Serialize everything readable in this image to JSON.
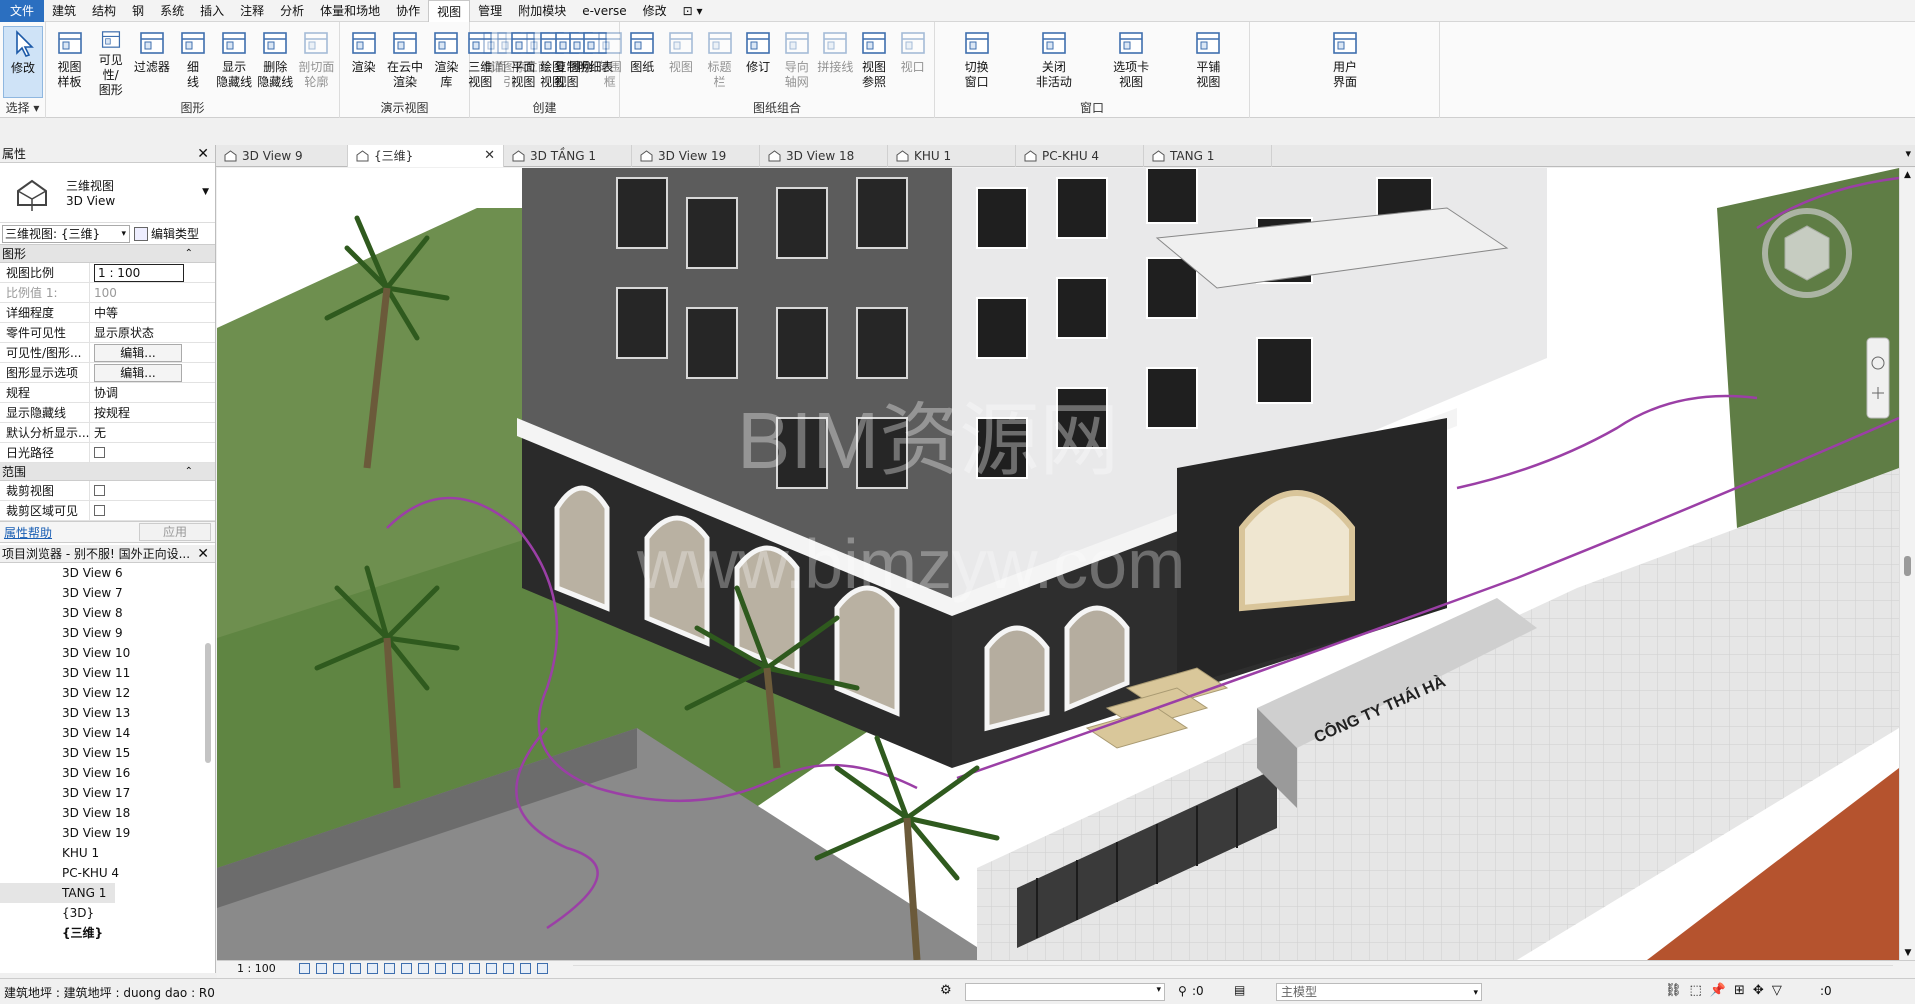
{
  "menus": [
    "文件",
    "建筑",
    "结构",
    "钢",
    "系统",
    "插入",
    "注释",
    "分析",
    "体量和场地",
    "协作",
    "视图",
    "管理",
    "附加模块",
    "e-verse",
    "修改",
    "⊡ ▾"
  ],
  "active_menu_index": 10,
  "ribbon": {
    "groups": [
      {
        "label": "选择 ▾",
        "buttons": [
          {
            "label": "修改",
            "icon": "cursor-icon",
            "selected": true
          }
        ]
      },
      {
        "label": "图形",
        "buttons": [
          {
            "label": "视图\n样板",
            "icon": "view-template-icon"
          },
          {
            "label": "可见性/\n图形",
            "icon": "visibility-icon"
          },
          {
            "label": "过滤器",
            "icon": "filter-icon"
          },
          {
            "label": "细\n线",
            "icon": "thin-lines-icon"
          },
          {
            "label": "显示\n隐藏线",
            "icon": "show-hidden-icon"
          },
          {
            "label": "删除\n隐藏线",
            "icon": "remove-hidden-icon"
          },
          {
            "label": "剖切面\n轮廓",
            "icon": "cut-profile-icon",
            "disabled": true
          }
        ]
      },
      {
        "label": "演示视图",
        "buttons": [
          {
            "label": "渲染",
            "icon": "render-teapot-icon"
          },
          {
            "label": "在云中\n渲染",
            "icon": "cloud-render-icon"
          },
          {
            "label": "渲染\n库",
            "icon": "render-gallery-icon"
          }
        ]
      },
      {
        "label": "创建",
        "buttons": [
          {
            "label": "三维\n视图",
            "icon": "3d-view-icon"
          },
          {
            "label": "剖面",
            "icon": "section-icon",
            "disabled": true
          },
          {
            "label": "详图索引",
            "icon": "callout-icon",
            "disabled": true
          },
          {
            "label": "平面\n视图",
            "icon": "plan-view-icon"
          },
          {
            "label": "立面",
            "icon": "elevation-icon",
            "disabled": true
          },
          {
            "label": "绘图\n视图",
            "icon": "drafting-view-icon"
          },
          {
            "label": "复制\n视图",
            "icon": "duplicate-view-icon"
          },
          {
            "label": "图例",
            "icon": "legend-icon"
          },
          {
            "label": "明细表",
            "icon": "schedule-icon"
          },
          {
            "label": "范围\n框",
            "icon": "scope-box-icon",
            "disabled": true
          }
        ]
      },
      {
        "label": "图纸组合",
        "buttons": [
          {
            "label": "图纸",
            "icon": "sheet-icon"
          },
          {
            "label": "视图",
            "icon": "view-place-icon",
            "disabled": true
          },
          {
            "label": "标题\n栏",
            "icon": "title-block-icon",
            "disabled": true
          },
          {
            "label": "修订",
            "icon": "revision-icon"
          },
          {
            "label": "导向\n轴网",
            "icon": "guide-grid-icon",
            "disabled": true
          },
          {
            "label": "拼接线",
            "icon": "matchline-icon",
            "disabled": true
          },
          {
            "label": "视图\n参照",
            "icon": "view-reference-icon"
          },
          {
            "label": "视口",
            "icon": "viewport-icon",
            "disabled": true
          }
        ]
      },
      {
        "label": "窗口",
        "buttons": [
          {
            "label": "切换\n窗口",
            "icon": "switch-window-icon"
          },
          {
            "label": "关闭\n非活动",
            "icon": "close-inactive-icon"
          },
          {
            "label": "选项卡\n视图",
            "icon": "tab-views-icon"
          },
          {
            "label": "平铺\n视图",
            "icon": "tile-views-icon"
          }
        ]
      },
      {
        "label": "",
        "buttons": [
          {
            "label": "用户\n界面",
            "icon": "user-interface-icon"
          }
        ]
      }
    ]
  },
  "properties": {
    "title": "属性",
    "type_name": "三维视图",
    "type_sub": "3D View",
    "instance_selector": "三维视图: {三维}",
    "edit_type": "编辑类型",
    "section_graphics": "图形",
    "rows": [
      {
        "k": "视图比例",
        "v": "1 : 100",
        "boxed": true
      },
      {
        "k": "比例值 1:",
        "v": "100",
        "grey": true
      },
      {
        "k": "详细程度",
        "v": "中等"
      },
      {
        "k": "零件可见性",
        "v": "显示原状态"
      },
      {
        "k": "可见性/图形...",
        "v": "编辑...",
        "button": true
      },
      {
        "k": "图形显示选项",
        "v": "编辑...",
        "button": true
      },
      {
        "k": "规程",
        "v": "协调"
      },
      {
        "k": "显示隐藏线",
        "v": "按规程"
      },
      {
        "k": "默认分析显示...",
        "v": "无"
      },
      {
        "k": "日光路径",
        "v": "",
        "check": true
      }
    ],
    "section_extents": "范围",
    "rows2": [
      {
        "k": "裁剪视图",
        "v": "",
        "check": true
      },
      {
        "k": "裁剪区域可见",
        "v": "",
        "check": true
      }
    ],
    "help": "属性帮助",
    "apply": "应用"
  },
  "browser": {
    "title": "项目浏览器 - 别不服! 国外正向设...",
    "items": [
      "3D View 6",
      "3D View 7",
      "3D View 8",
      "3D View 9",
      "3D View 10",
      "3D View 11",
      "3D View 12",
      "3D View 13",
      "3D View 14",
      "3D View 15",
      "3D View 16",
      "3D View 17",
      "3D View 18",
      "3D View 19",
      "KHU 1",
      "PC-KHU 4",
      "TANG 1",
      "{3D}",
      "{三维}"
    ],
    "selected_index": 16,
    "bold_index": 18
  },
  "tabs": [
    {
      "label": "3D View 9"
    },
    {
      "label": "{三维}",
      "active": true,
      "closable": true
    },
    {
      "label": "3D TẦNG 1"
    },
    {
      "label": "3D View 19"
    },
    {
      "label": "3D View 18"
    },
    {
      "label": "KHU 1"
    },
    {
      "label": "PC-KHU 4"
    },
    {
      "label": "TANG 1"
    }
  ],
  "viewport": {
    "watermark_1": "BIM资源网",
    "watermark_2": "www.bimzyw.com",
    "sign_text": "CÔNG TY THÁI HÀ"
  },
  "viewbar": {
    "scale": "1 : 100"
  },
  "status": {
    "left": "建筑地坪 : 建筑地坪 : duong dao : R0",
    "coord": ":0",
    "model": "主模型",
    "filter": ":0"
  }
}
